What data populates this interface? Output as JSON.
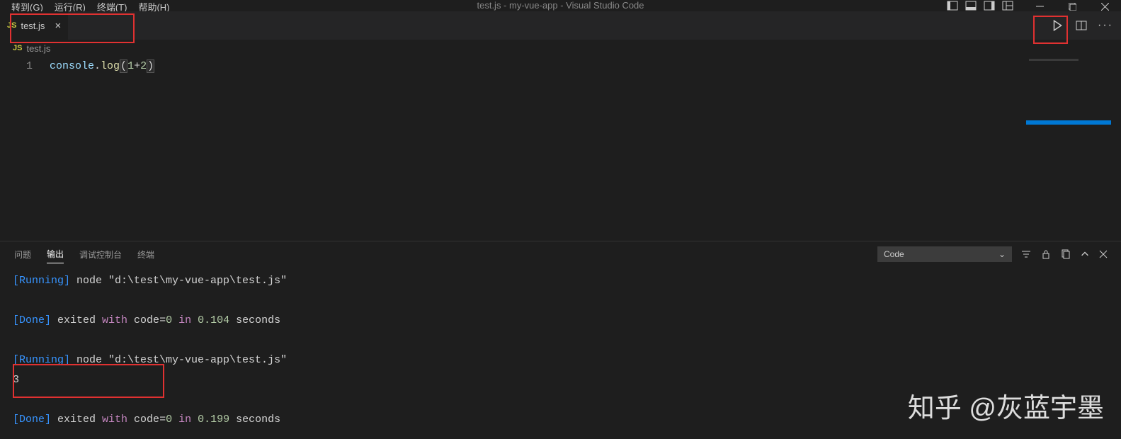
{
  "menubar": {
    "items": [
      "转到(G)",
      "运行(R)",
      "终端(T)",
      "帮助(H)"
    ],
    "title": "test.js - my-vue-app - Visual Studio Code"
  },
  "tab": {
    "icon": "JS",
    "name": "test.js"
  },
  "breadcrumb": {
    "icon": "JS",
    "file": "test.js"
  },
  "editor": {
    "line_number": "1",
    "tokens": {
      "obj": "console",
      "dot": ".",
      "method": "log",
      "lp": "(",
      "n1": "1",
      "op": "+",
      "n2": "2",
      "rp": ")"
    }
  },
  "panel": {
    "tabs": [
      "问题",
      "输出",
      "调试控制台",
      "终端"
    ],
    "active_tab_index": 1,
    "filter_label": "Code"
  },
  "output": {
    "lines": [
      {
        "tag": "[Running]",
        "text": " node \"d:\\test\\my-vue-app\\test.js\""
      },
      {
        "blank": true
      },
      {
        "tag": "[Done]",
        "rich": true,
        "t1": " exited ",
        "kw1": "with",
        "t2": " code",
        "eq": "=",
        "num1": "0",
        "t3": " ",
        "kw2": "in",
        "t4": " ",
        "num2": "0.104",
        "t5": " seconds"
      },
      {
        "blank": true
      },
      {
        "tag": "[Running]",
        "text": " node \"d:\\test\\my-vue-app\\test.js\""
      },
      {
        "plain": "3"
      },
      {
        "blank": true
      },
      {
        "tag": "[Done]",
        "rich": true,
        "t1": " exited ",
        "kw1": "with",
        "t2": " code",
        "eq": "=",
        "num1": "0",
        "t3": " ",
        "kw2": "in",
        "t4": " ",
        "num2": "0.199",
        "t5": " seconds"
      }
    ]
  },
  "watermark": "知乎 @灰蓝宇墨"
}
